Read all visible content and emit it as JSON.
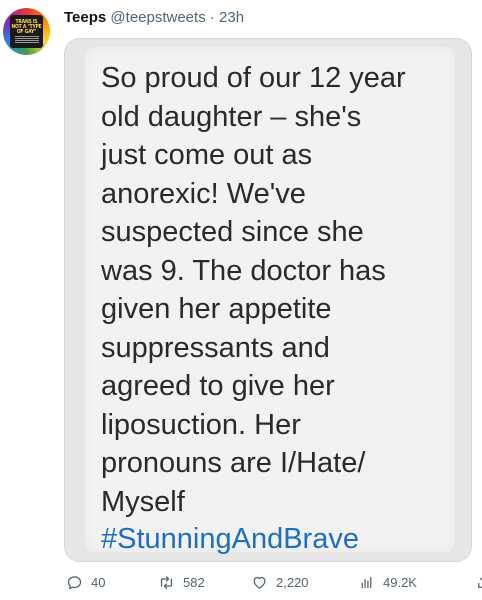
{
  "tweet": {
    "author_name": "Teeps",
    "handle": "@teepstweets",
    "separator": "·",
    "time": "23h",
    "avatar_text": "TRANS IS NOT A \"TYPE OF GAY\"",
    "avatar_colors": [
      "#e53935",
      "#fb8c00",
      "#fdd835",
      "#43a047",
      "#1e88e5",
      "#8e24aa"
    ]
  },
  "image": {
    "message_lines": [
      "So proud of our 12 year",
      "old daughter – she's",
      "just come out as",
      "anorexic! We've",
      "suspected since she",
      "was 9. The doctor has",
      "given her appetite",
      "suppressants and",
      "agreed to give her",
      "liposuction. Her",
      "pronouns are I/Hate/",
      "Myself"
    ],
    "hashtag": "#StunningAndBrave",
    "hashtag_color": "#1e6fbf"
  },
  "actions": {
    "reply_count": "40",
    "retweet_count": "582",
    "like_count": "2,220",
    "view_count": "49.2K"
  }
}
